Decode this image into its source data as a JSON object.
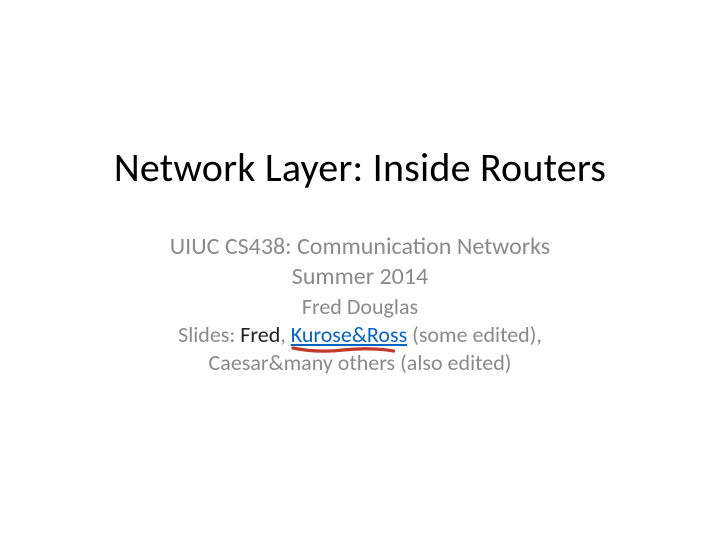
{
  "title": "Network Layer: Inside Routers",
  "subtitle": {
    "course": "UIUC CS438: Communication Networks",
    "term": "Summer 2014",
    "author": "Fred Douglas",
    "slides_prefix": "Slides: ",
    "fred": "Fred",
    "comma1": ", ",
    "kurose_ross": "Kurose&Ross",
    "after_kurose": " (some edited),",
    "others": "Caesar&many others (also edited)"
  }
}
